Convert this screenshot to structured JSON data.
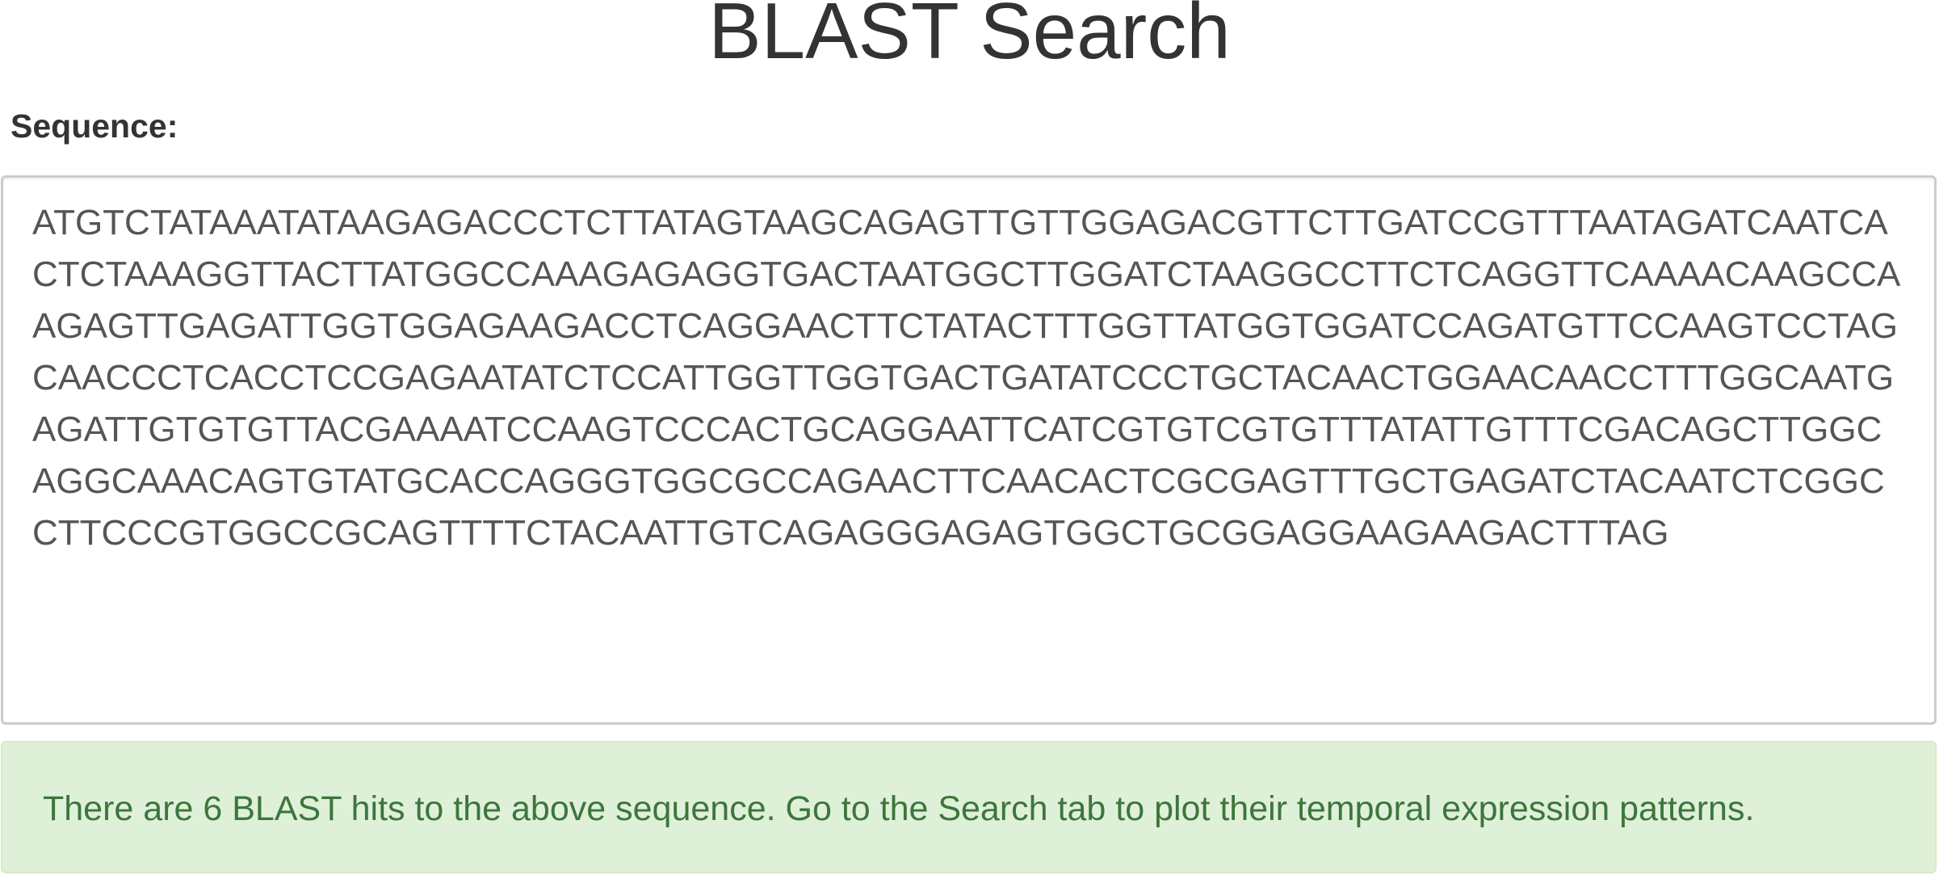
{
  "page": {
    "title": "BLAST Search"
  },
  "form": {
    "sequence_label": "Sequence:",
    "sequence_value": "ATGTCTATAAATATAAGAGACCCTCTTATAGTAAGCAGAGTTGTTGGAGACGTTCTTGATCCGTTTAATAGATCAATCACTCTAAAGGTTACTTATGGCCAAAGAGAGGTGACTAATGGCTTGGATCTAAGGCCTTCTCAGGTTCAAAACAAGCCAAGAGTTGAGATTGGTGGAGAAGACCTCAGGAACTTCTATACTTTGGTTATGGTGGATCCAGATGTTCCAAGTCCTAGCAACCCTCACCTCCGAGAATATCTCCATTGGTTGGTGACTGATATCCCTGCTACAACTGGAACAACCTTTGGCAATGAGATTGTGTGTTACGAAAATCCAAGTCCCACTGCAGGAATTCATCGTGTCGTGTTTATATTGTTTCGACAGCTTGGCAGGCAAACAGTGTATGCACCAGGGTGGCGCCAGAACTTCAACACTCGCGAGTTTGCTGAGATCTACAATCTCGGCCTTCCCGTGGCCGCAGTTTTCTACAATTGTCAGAGGGAGAGTGGCTGCGGAGGAAGAAGACTTTAG"
  },
  "alert": {
    "message": "There are 6 BLAST hits to the above sequence. Go to the Search tab to plot their temporal expression patterns."
  },
  "colors": {
    "alert_background": "#dff0d8",
    "alert_text": "#3c763d",
    "input_border": "#cccccc",
    "heading_text": "#333333"
  }
}
